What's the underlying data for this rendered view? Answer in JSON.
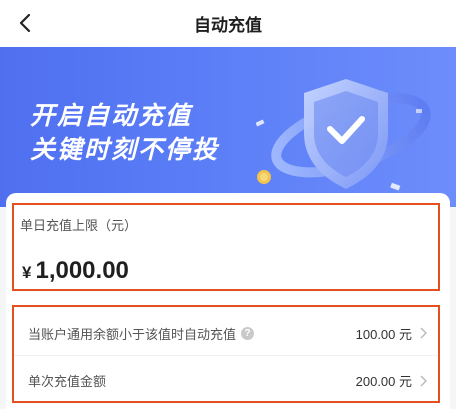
{
  "header": {
    "title": "自动充值"
  },
  "banner": {
    "line1": "开启自动充值",
    "line2": "关键时刻不停投"
  },
  "daily_limit": {
    "label": "单日充值上限（元）",
    "currency_symbol": "¥",
    "amount": "1,000.00"
  },
  "settings": {
    "rows": [
      {
        "label": "当账户通用余额小于该值时自动充值",
        "help_icon": "?",
        "value": "100.00 元"
      },
      {
        "label": "单次充值金额",
        "value": "200.00 元"
      }
    ]
  },
  "colors": {
    "accent_border": "#e4501e",
    "banner_blue": "#5b7ef7"
  }
}
